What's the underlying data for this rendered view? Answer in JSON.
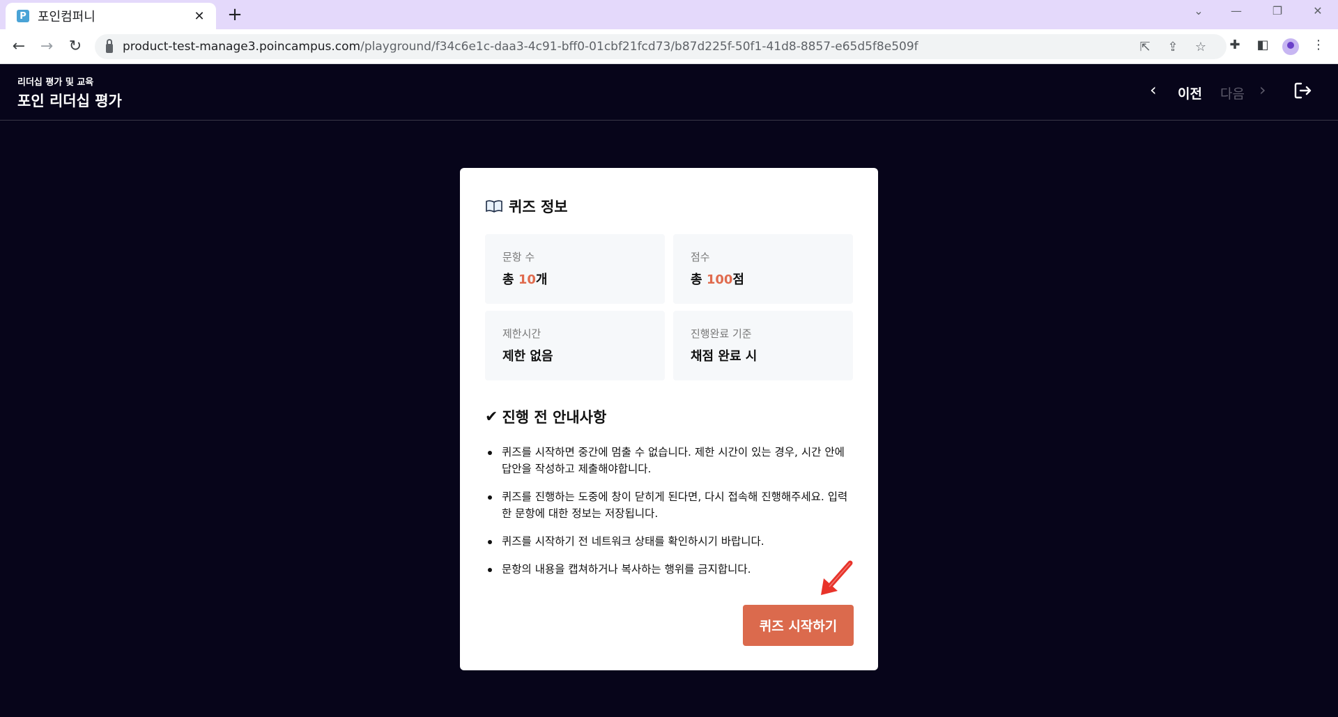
{
  "browser": {
    "tab_title": "포인컴퍼니",
    "favicon_letter": "P",
    "url_host": "product-test-manage3.poincampus.com",
    "url_path": "/playground/f34c6e1c-daa3-4c91-bff0-01cbf21fcd73/b87d225f-50f1-41d8-8857-e65d5f8e509f"
  },
  "header": {
    "subtitle": "리더십 평가 및 교육",
    "title": "포인 리더십 평가",
    "prev_label": "이전",
    "next_label": "다음"
  },
  "quiz_info": {
    "title": "퀴즈 정보",
    "items": [
      {
        "label": "문항 수",
        "prefix": "총 ",
        "value": "10",
        "suffix": "개"
      },
      {
        "label": "점수",
        "prefix": "총 ",
        "value": "100",
        "suffix": "점"
      },
      {
        "label": "제한시간",
        "prefix": "",
        "value": "",
        "suffix": "제한 없음"
      },
      {
        "label": "진행완료 기준",
        "prefix": "",
        "value": "",
        "suffix": "채점 완료 시"
      }
    ]
  },
  "notice": {
    "title": "진행 전 안내사항",
    "items": [
      "퀴즈를 시작하면 중간에 멈출 수 없습니다. 제한 시간이 있는 경우, 시간 안에 답안을 작성하고 제출해야합니다.",
      "퀴즈를 진행하는 도중에 창이 닫히게 된다면, 다시 접속해 진행해주세요. 입력한 문항에 대한 정보는 저장됩니다.",
      "퀴즈를 시작하기 전 네트워크 상태를 확인하시기 바랍니다.",
      "문항의 내용을 캡쳐하거나 복사하는 행위를 금지합니다."
    ]
  },
  "start_button_label": "퀴즈 시작하기",
  "colors": {
    "accent": "#db6a4d",
    "accent_text": "#e06b4e",
    "background": "#07051a",
    "annotation": "#e8332a"
  },
  "icons": [
    "book-icon",
    "check-icon",
    "chevron-left-icon",
    "chevron-right-icon",
    "exit-icon",
    "red-arrow-annotation"
  ]
}
